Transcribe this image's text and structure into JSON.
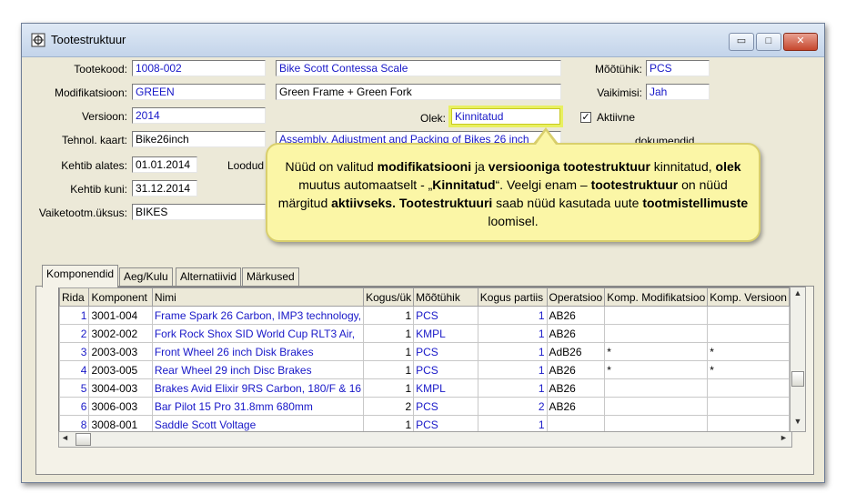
{
  "window": {
    "title": "Tootestruktuur",
    "buttons": {
      "minimize": "▭",
      "maximize": "□",
      "close": "✕"
    }
  },
  "form": {
    "tootekood_label": "Tootekood:",
    "tootekood_value": "1008-002",
    "tootekood_desc": "Bike Scott Contessa Scale",
    "modifikatsioon_label": "Modifikatsioon:",
    "modifikatsioon_value": "GREEN",
    "modifikatsioon_desc": "Green Frame + Green Fork",
    "versioon_label": "Versioon:",
    "versioon_value": "2014",
    "tehnol_label": "Tehnol. kaart:",
    "tehnol_value": "Bike26inch",
    "tehnol_desc": "Assembly, Adjustment and Packing of Bikes 26 inch",
    "kehtib_alates_label": "Kehtib alates:",
    "kehtib_alates_value": "01.01.2014",
    "loodud_label": "Loodud",
    "kehtib_kuni_label": "Kehtib kuni:",
    "kehtib_kuni_value": "31.12.2014",
    "vaiketootm_label": "Vaiketootm.üksus:",
    "vaiketootm_value": "BIKES",
    "olek_label": "Olek:",
    "olek_value": "Kinnitatud",
    "mootuhik_label": "Mõõtühik:",
    "mootuhik_value": "PCS",
    "vaikimisi_label": "Vaikimisi:",
    "vaikimisi_value": "Jah",
    "aktiivne_label": "Aktiivne",
    "aktiivne_checked": "✓",
    "dokumendid_label": "dokumendid"
  },
  "callout": {
    "parts": [
      {
        "t": "Nüüd on valitud ",
        "b": false
      },
      {
        "t": "modifikatsiooni",
        "b": true
      },
      {
        "t": " ja ",
        "b": false
      },
      {
        "t": "versiooniga tootestruktuur",
        "b": true
      },
      {
        "t": " kinnitatud, ",
        "b": false
      },
      {
        "t": "olek",
        "b": true
      },
      {
        "t": " muutus automaatselt - „",
        "b": false
      },
      {
        "t": "Kinnitatud",
        "b": true
      },
      {
        "t": "“.  Veelgi enam – ",
        "b": false
      },
      {
        "t": "tootestruktuur",
        "b": true
      },
      {
        "t": " on nüüd märgitud ",
        "b": false
      },
      {
        "t": "aktiivseks.",
        "b": true
      },
      {
        "t": "  ",
        "b": false
      },
      {
        "t": "Tootestruktuuri",
        "b": true
      },
      {
        "t": " saab nüüd kasutada uute ",
        "b": false
      },
      {
        "t": "tootmistellimuste",
        "b": true
      },
      {
        "t": " loomisel.",
        "b": false
      }
    ]
  },
  "tabs": [
    {
      "label": "Komponendid",
      "active": true
    },
    {
      "label": "Aeg/Kulu",
      "active": false
    },
    {
      "label": "Alternatiivid",
      "active": false
    },
    {
      "label": "Märkused",
      "active": false
    }
  ],
  "table": {
    "columns": [
      "Rida",
      "Komponent",
      "Nimi",
      "Kogus/ük",
      "Mõõtühik",
      "Kogus partiis",
      "Operatsioo",
      "Komp. Modifikatsioo",
      "Komp. Versioon"
    ],
    "rows": [
      [
        "1",
        "3001-004",
        "Frame Spark 26 Carbon, IMP3 technology,",
        "1",
        "PCS",
        "1",
        "AB26",
        "",
        ""
      ],
      [
        "2",
        "3002-002",
        "Fork Rock Shox SID World Cup RLT3 Air,",
        "1",
        "KMPL",
        "1",
        "AB26",
        "",
        ""
      ],
      [
        "3",
        "2003-003",
        "Front Wheel 26 inch Disk Brakes",
        "1",
        "PCS",
        "1",
        "AdB26",
        "*",
        "*"
      ],
      [
        "4",
        "2003-005",
        "Rear Wheel 29 inch Disc Brakes",
        "1",
        "PCS",
        "1",
        "AB26",
        "*",
        "*"
      ],
      [
        "5",
        "3004-003",
        "Brakes Avid Elixir 9RS Carbon, 180/F & 16",
        "1",
        "KMPL",
        "1",
        "AB26",
        "",
        ""
      ],
      [
        "6",
        "3006-003",
        "Bar Pilot 15 Pro 31.8mm 680mm",
        "2",
        "PCS",
        "2",
        "AB26",
        "",
        ""
      ],
      [
        "8",
        "3008-001",
        "Saddle Scott Voltage",
        "1",
        "PCS",
        "1",
        "",
        "",
        ""
      ]
    ]
  },
  "scroll": {
    "up": "▲",
    "down": "▼",
    "left": "◄",
    "right": "►"
  }
}
